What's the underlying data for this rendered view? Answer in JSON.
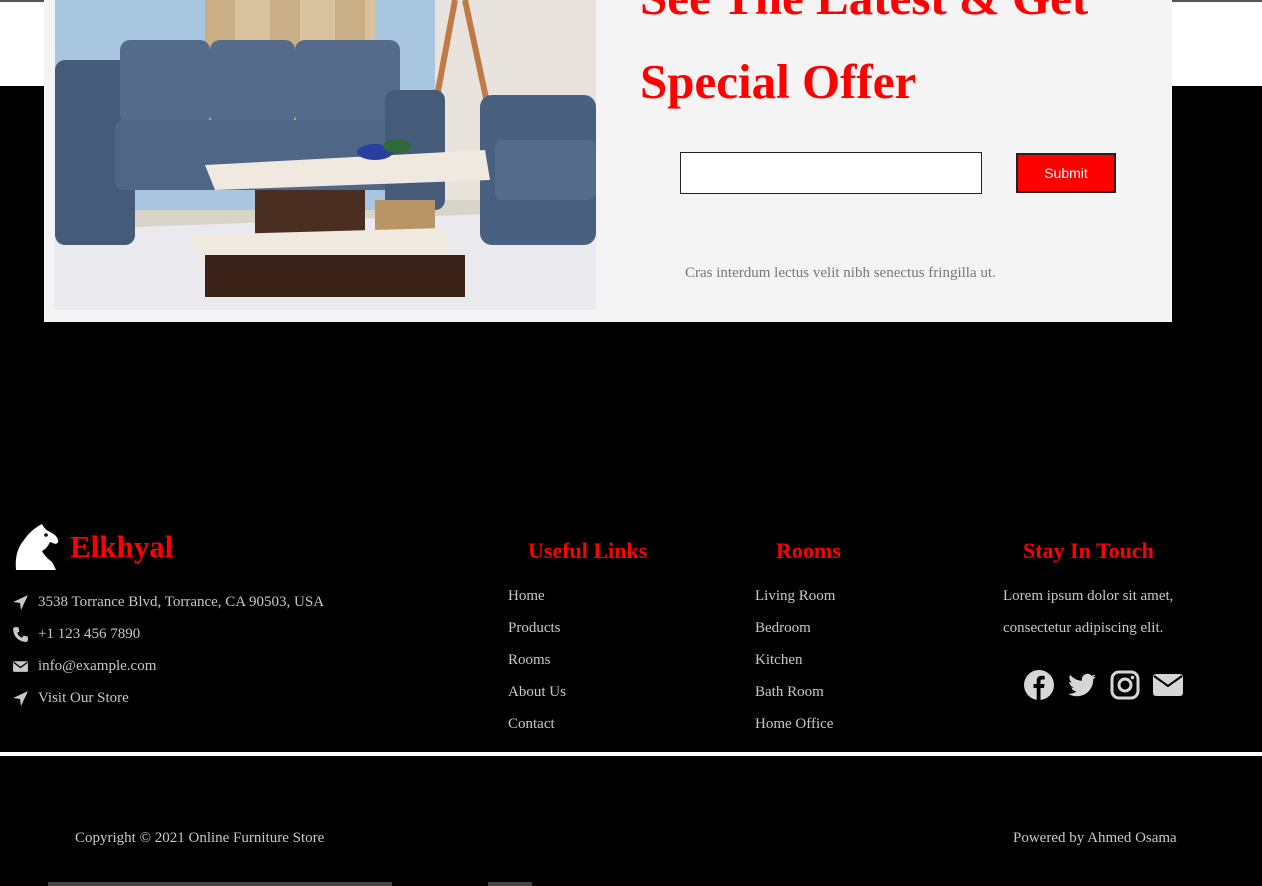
{
  "promo": {
    "heading_line1": "See The Latest & Get",
    "heading_line2": "Special Offer",
    "email_value": "",
    "submit_label": "Submit",
    "note": "Cras interdum lectus velit nibh senectus fringilla ut."
  },
  "footer": {
    "brand_name": "Elkhyal",
    "contact": [
      {
        "icon": "location-arrow-icon",
        "text": "3538 Torrance Blvd, Torrance, CA 90503, USA"
      },
      {
        "icon": "phone-icon",
        "text": "+1 123 456 7890"
      },
      {
        "icon": "envelope-icon",
        "text": "info@example.com"
      },
      {
        "icon": "location-arrow-icon",
        "text": "Visit Our Store"
      }
    ],
    "useful_links": {
      "title": "Useful Links",
      "items": [
        "Home",
        "Products",
        "Rooms",
        "About Us",
        "Contact"
      ]
    },
    "rooms": {
      "title": "Rooms",
      "items": [
        "Living Room",
        "Bedroom",
        "Kitchen",
        "Bath Room",
        "Home Office"
      ]
    },
    "stay_in_touch": {
      "title": "Stay In Touch",
      "text": "Lorem ipsum dolor sit amet, consectetur adipiscing elit.",
      "socials": [
        "facebook-icon",
        "twitter-icon",
        "instagram-icon",
        "envelope-icon"
      ]
    },
    "copyright": "Copyright © 2021 Online Furniture Store",
    "powered_by": "Powered by Ahmed Osama"
  },
  "colors": {
    "accent": "#ff0000",
    "footer_bg": "#000000",
    "promo_bg": "#f4f4f4",
    "footer_text": "#c8c8c8"
  }
}
